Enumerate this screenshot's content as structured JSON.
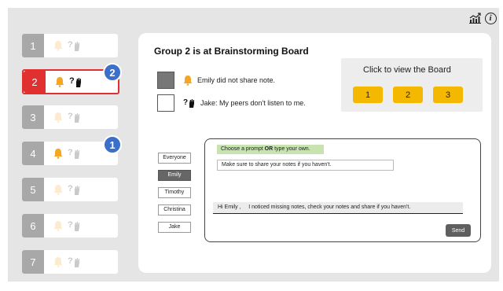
{
  "toolbar": {
    "icons": [
      "chart-icon",
      "info-icon"
    ],
    "info_glyph": "i"
  },
  "groups": [
    {
      "num": "1",
      "state": "inactive",
      "icons": [
        "bell-icon",
        "question-hand-icon"
      ]
    },
    {
      "num": "2",
      "state": "active",
      "icons": [
        "bell-icon",
        "question-hand-icon"
      ],
      "badge": "2"
    },
    {
      "num": "3",
      "state": "inactive",
      "icons": [
        "bell-icon",
        "question-hand-icon"
      ]
    },
    {
      "num": "4",
      "state": "inactive",
      "icons": [
        "bell-icon",
        "question-hand-icon"
      ],
      "badge": "1",
      "bell_highlighted": true
    },
    {
      "num": "5",
      "state": "inactive",
      "icons": [
        "bell-icon",
        "question-hand-icon"
      ]
    },
    {
      "num": "6",
      "state": "inactive",
      "icons": [
        "bell-icon",
        "question-hand-icon"
      ]
    },
    {
      "num": "7",
      "state": "inactive",
      "icons": [
        "bell-icon",
        "question-hand-icon"
      ]
    }
  ],
  "main": {
    "title": "Group 2 is at Brainstorming Board",
    "status": [
      {
        "text": "Emily did not share note.",
        "icon": "bell-icon",
        "square": "filled"
      },
      {
        "text": "Jake: My peers don't listen to me.",
        "icon": "question-hand-icon",
        "square": "empty"
      }
    ],
    "board": {
      "label": "Click to view the Board",
      "buttons": [
        "1",
        "2",
        "3"
      ]
    }
  },
  "recipients": [
    {
      "label": "Everyone",
      "selected": false
    },
    {
      "label": "Emily",
      "selected": true
    },
    {
      "label": "Timothy",
      "selected": false
    },
    {
      "label": "Christina",
      "selected": false
    },
    {
      "label": "Jake",
      "selected": false
    }
  ],
  "chat": {
    "prompt_pre": "Choose a prompt ",
    "prompt_bold": "OR",
    "prompt_post": " type your own.",
    "suggestion": "Make sure to share your notes if you haven't.",
    "message": "Hi Emily ,     I noticed missing notes, check your notes and share if you haven't.",
    "send": "Send"
  },
  "colors": {
    "active_red": "#e03030",
    "badge_blue": "#3b6fc9",
    "board_yellow": "#f5b800",
    "bell_orange": "#f5a623",
    "prompt_green": "#c6e3b0"
  }
}
